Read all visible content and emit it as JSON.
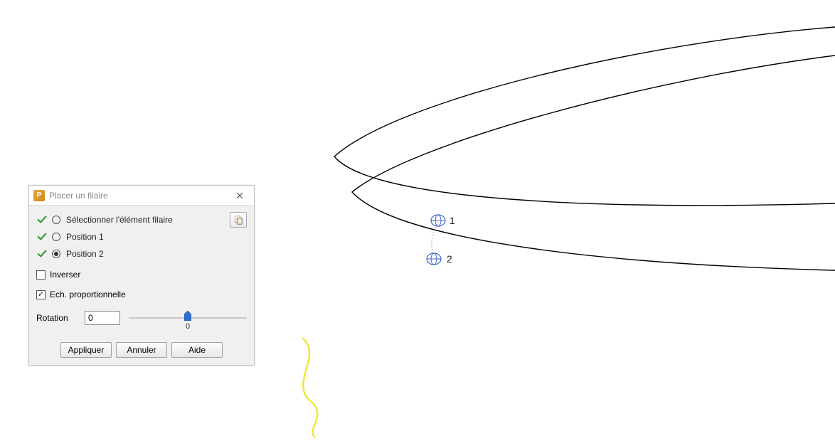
{
  "dialog": {
    "title": "Placer un filaire",
    "steps": {
      "select_element": {
        "label": "Sélectionner l'élément filaire",
        "completed": true,
        "selected": false
      },
      "position1": {
        "label": "Position 1",
        "completed": true,
        "selected": false
      },
      "position2": {
        "label": "Position 2",
        "completed": true,
        "selected": true
      }
    },
    "options": {
      "invert": {
        "label": "Inverser",
        "checked": false
      },
      "proportional": {
        "label": "Ech. proportionnelle",
        "checked": true
      }
    },
    "rotation": {
      "label": "Rotation",
      "value": "0",
      "slider_display": "0"
    },
    "buttons": {
      "apply": "Appliquer",
      "cancel": "Annuler",
      "help": "Aide"
    }
  },
  "canvas": {
    "markers": {
      "m1": "1",
      "m2": "2"
    }
  }
}
